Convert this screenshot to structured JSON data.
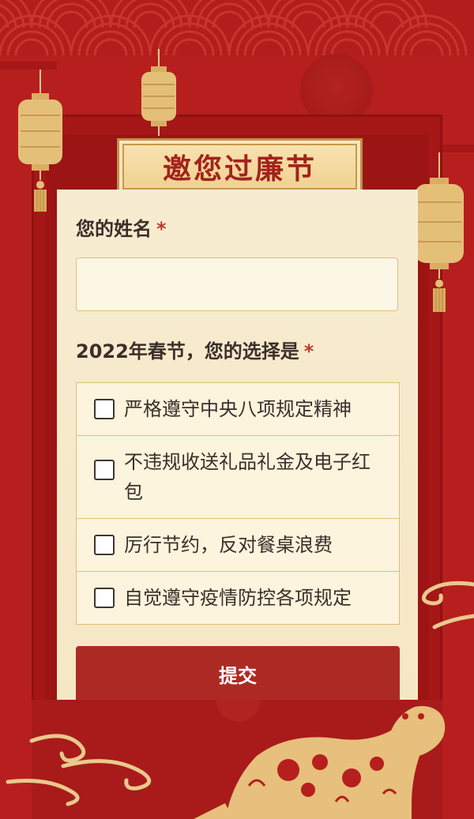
{
  "title": "邀您过廉节",
  "form": {
    "name_question": "您的姓名",
    "required_mark": "*",
    "name_value": "",
    "choice_question": "2022年春节，您的选择是",
    "options": [
      {
        "label": "严格遵守中央八项规定精神",
        "checked": false
      },
      {
        "label": "不违规收送礼品礼金及电子红包",
        "checked": false
      },
      {
        "label": "厉行节约，反对餐桌浪费",
        "checked": false
      },
      {
        "label": "自觉遵守疫情防控各项规定",
        "checked": false
      }
    ],
    "submit_label": "提交"
  },
  "colors": {
    "background": "#b61f1e",
    "card": "#f7ecd1",
    "gold": "#e0bd79",
    "submit": "#ad2a24",
    "title_text": "#a3221c"
  },
  "decorations": [
    "lantern-icon",
    "tiger-papercut-icon",
    "cloud-swirl-icon",
    "wave-pattern"
  ]
}
